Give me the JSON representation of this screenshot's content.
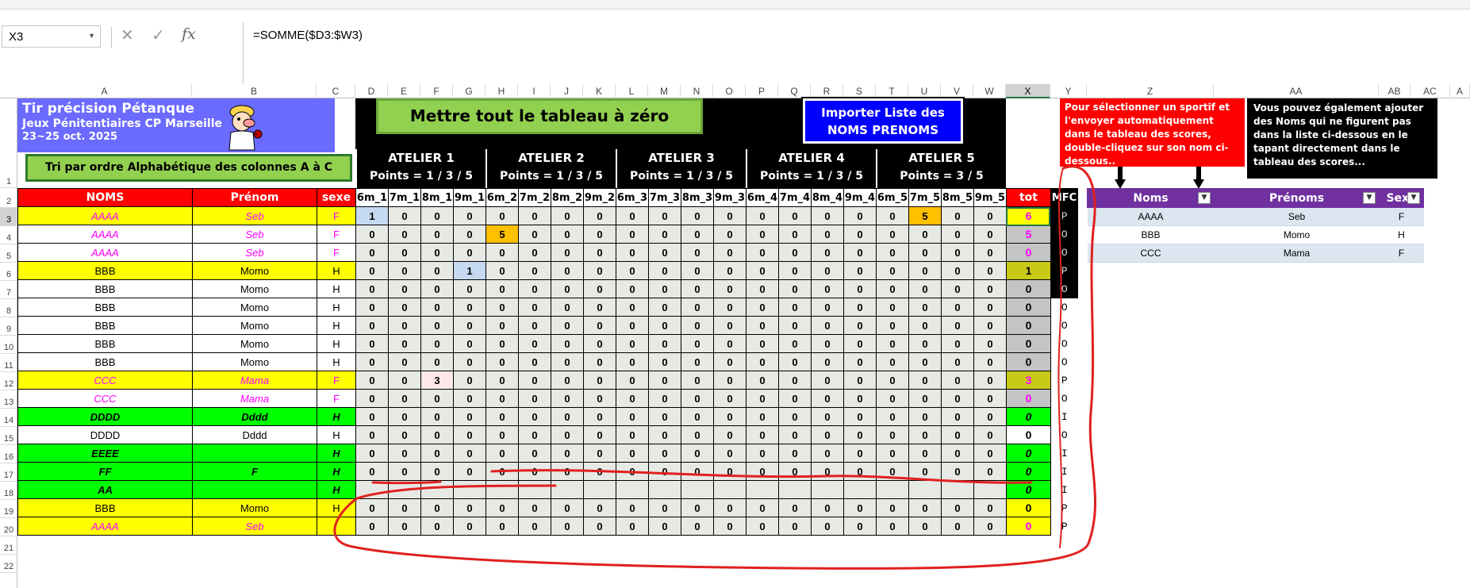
{
  "namebox": {
    "value": "X3"
  },
  "formula": {
    "value": "=SOMME($D3:$W3)"
  },
  "columns": [
    "A",
    "B",
    "C",
    "D",
    "E",
    "F",
    "G",
    "H",
    "I",
    "J",
    "K",
    "L",
    "M",
    "N",
    "O",
    "P",
    "Q",
    "R",
    "S",
    "T",
    "U",
    "V",
    "W",
    "X",
    "Y",
    "Z",
    "AA",
    "AB",
    "AC",
    "A"
  ],
  "row_numbers": [
    "1",
    "2",
    "3",
    "4",
    "5",
    "6",
    "7",
    "8",
    "9",
    "10",
    "11",
    "12",
    "13",
    "14",
    "15",
    "16",
    "17",
    "18",
    "19",
    "20",
    "21",
    "22"
  ],
  "title": {
    "main": "Tir précision Pétanque",
    "sub": "Jeux Pénitentiaires CP Marseille",
    "date": "23~25 oct. 2025"
  },
  "buttons": {
    "sort": "Tri par ordre Alphabétique des colonnes A à C",
    "reset": "Mettre tout le tableau à zéro",
    "import_line1": "Importer Liste des",
    "import_line2": "NOMS PRENOMS"
  },
  "ateliers": [
    {
      "name": "ATELIER 1",
      "points": "Points = 1 / 3 / 5"
    },
    {
      "name": "ATELIER 2",
      "points": "Points = 1 / 3 / 5"
    },
    {
      "name": "ATELIER 3",
      "points": "Points = 1 / 3 / 5"
    },
    {
      "name": "ATELIER 4",
      "points": "Points = 1 / 3 / 5"
    },
    {
      "name": "ATELIER 5",
      "points": "Points = 3 / 5"
    }
  ],
  "info_red": "Pour sélectionner un sportif et l'envoyer automatiquement dans le tableau des scores, double-cliquez sur son nom ci-dessous..",
  "info_black": "Vous pouvez également ajouter des Noms qui ne figurent pas dans la liste ci-dessous en le tapant directement dans le tableau des scores...",
  "headers": {
    "noms": "NOMS",
    "prenom": "Prénom",
    "sexe": "sexe",
    "tot": "tot",
    "mfc": "MFC",
    "scores": [
      "6m_1",
      "7m_1",
      "8m_1",
      "9m_1",
      "6m_2",
      "7m_2",
      "8m_2",
      "9m_2",
      "6m_3",
      "7m_3",
      "8m_3",
      "9m_3",
      "6m_4",
      "7m_4",
      "8m_4",
      "9m_4",
      "6m_5",
      "7m_5",
      "8m_5",
      "9m_5"
    ]
  },
  "rows": [
    {
      "nom": "AAAA",
      "prenom": "Seb",
      "sexe": "F",
      "style": "yellow-mag",
      "scores": [
        "1",
        "0",
        "0",
        "0",
        "0",
        "0",
        "0",
        "0",
        "0",
        "0",
        "0",
        "0",
        "0",
        "0",
        "0",
        "0",
        "0",
        "5",
        "0",
        "0"
      ],
      "tot": "6",
      "mfc": "P"
    },
    {
      "nom": "AAAA",
      "prenom": "Seb",
      "sexe": "F",
      "style": "white-mag",
      "scores": [
        "0",
        "0",
        "0",
        "0",
        "5",
        "0",
        "0",
        "0",
        "0",
        "0",
        "0",
        "0",
        "0",
        "0",
        "0",
        "0",
        "0",
        "0",
        "0",
        "0"
      ],
      "tot": "5",
      "mfc": "O"
    },
    {
      "nom": "AAAA",
      "prenom": "Seb",
      "sexe": "F",
      "style": "white-mag",
      "scores": [
        "0",
        "0",
        "0",
        "0",
        "0",
        "0",
        "0",
        "0",
        "0",
        "0",
        "0",
        "0",
        "0",
        "0",
        "0",
        "0",
        "0",
        "0",
        "0",
        "0"
      ],
      "tot": "0",
      "mfc": "O"
    },
    {
      "nom": "BBB",
      "prenom": "Momo",
      "sexe": "H",
      "style": "yellow",
      "scores": [
        "0",
        "0",
        "0",
        "1",
        "0",
        "0",
        "0",
        "0",
        "0",
        "0",
        "0",
        "0",
        "0",
        "0",
        "0",
        "0",
        "0",
        "0",
        "0",
        "0"
      ],
      "tot": "1",
      "mfc": "P"
    },
    {
      "nom": "BBB",
      "prenom": "Momo",
      "sexe": "H",
      "style": "white",
      "scores": [
        "0",
        "0",
        "0",
        "0",
        "0",
        "0",
        "0",
        "0",
        "0",
        "0",
        "0",
        "0",
        "0",
        "0",
        "0",
        "0",
        "0",
        "0",
        "0",
        "0"
      ],
      "tot": "0",
      "mfc": "O"
    },
    {
      "nom": "BBB",
      "prenom": "Momo",
      "sexe": "H",
      "style": "white",
      "scores": [
        "0",
        "0",
        "0",
        "0",
        "0",
        "0",
        "0",
        "0",
        "0",
        "0",
        "0",
        "0",
        "0",
        "0",
        "0",
        "0",
        "0",
        "0",
        "0",
        "0"
      ],
      "tot": "0",
      "mfc": "O"
    },
    {
      "nom": "BBB",
      "prenom": "Momo",
      "sexe": "H",
      "style": "white",
      "scores": [
        "0",
        "0",
        "0",
        "0",
        "0",
        "0",
        "0",
        "0",
        "0",
        "0",
        "0",
        "0",
        "0",
        "0",
        "0",
        "0",
        "0",
        "0",
        "0",
        "0"
      ],
      "tot": "0",
      "mfc": "O"
    },
    {
      "nom": "BBB",
      "prenom": "Momo",
      "sexe": "H",
      "style": "white",
      "scores": [
        "0",
        "0",
        "0",
        "0",
        "0",
        "0",
        "0",
        "0",
        "0",
        "0",
        "0",
        "0",
        "0",
        "0",
        "0",
        "0",
        "0",
        "0",
        "0",
        "0"
      ],
      "tot": "0",
      "mfc": "O"
    },
    {
      "nom": "BBB",
      "prenom": "Momo",
      "sexe": "H",
      "style": "white",
      "scores": [
        "0",
        "0",
        "0",
        "0",
        "0",
        "0",
        "0",
        "0",
        "0",
        "0",
        "0",
        "0",
        "0",
        "0",
        "0",
        "0",
        "0",
        "0",
        "0",
        "0"
      ],
      "tot": "0",
      "mfc": "O"
    },
    {
      "nom": "CCC",
      "prenom": "Mama",
      "sexe": "F",
      "style": "yellow-mag",
      "scores": [
        "0",
        "0",
        "3",
        "0",
        "0",
        "0",
        "0",
        "0",
        "0",
        "0",
        "0",
        "0",
        "0",
        "0",
        "0",
        "0",
        "0",
        "0",
        "0",
        "0"
      ],
      "tot": "3",
      "mfc": "P"
    },
    {
      "nom": "CCC",
      "prenom": "Mama",
      "sexe": "F",
      "style": "white-mag",
      "scores": [
        "0",
        "0",
        "0",
        "0",
        "0",
        "0",
        "0",
        "0",
        "0",
        "0",
        "0",
        "0",
        "0",
        "0",
        "0",
        "0",
        "0",
        "0",
        "0",
        "0"
      ],
      "tot": "0",
      "mfc": "O"
    },
    {
      "nom": "DDDD",
      "prenom": "Dddd",
      "sexe": "H",
      "style": "green",
      "scores": [
        "0",
        "0",
        "0",
        "0",
        "0",
        "0",
        "0",
        "0",
        "0",
        "0",
        "0",
        "0",
        "0",
        "0",
        "0",
        "0",
        "0",
        "0",
        "0",
        "0"
      ],
      "tot": "0",
      "mfc": "I"
    },
    {
      "nom": "DDDD",
      "prenom": "Dddd",
      "sexe": "H",
      "style": "white",
      "scores": [
        "0",
        "0",
        "0",
        "0",
        "0",
        "0",
        "0",
        "0",
        "0",
        "0",
        "0",
        "0",
        "0",
        "0",
        "0",
        "0",
        "0",
        "0",
        "0",
        "0"
      ],
      "tot": "0",
      "mfc": "O"
    },
    {
      "nom": "EEEE",
      "prenom": "",
      "sexe": "H",
      "style": "green",
      "scores": [
        "0",
        "0",
        "0",
        "0",
        "0",
        "0",
        "0",
        "0",
        "0",
        "0",
        "0",
        "0",
        "0",
        "0",
        "0",
        "0",
        "0",
        "0",
        "0",
        "0"
      ],
      "tot": "0",
      "mfc": "I"
    },
    {
      "nom": "FF",
      "prenom": "F",
      "sexe": "H",
      "style": "green",
      "scores": [
        "0",
        "0",
        "0",
        "0",
        "0",
        "0",
        "0",
        "0",
        "0",
        "0",
        "0",
        "0",
        "0",
        "0",
        "0",
        "0",
        "0",
        "0",
        "0",
        "0"
      ],
      "tot": "0",
      "mfc": "I"
    },
    {
      "nom": "AA",
      "prenom": "",
      "sexe": "H",
      "style": "green",
      "scores": [
        "",
        "",
        "",
        "",
        "",
        "",
        "",
        "",
        "",
        "",
        "",
        "",
        "",
        "",
        "",
        "",
        "",
        "",
        "",
        ""
      ],
      "tot": "0",
      "mfc": "I"
    },
    {
      "nom": "BBB",
      "prenom": "Momo",
      "sexe": "H",
      "style": "yellow",
      "scores": [
        "0",
        "0",
        "0",
        "0",
        "0",
        "0",
        "0",
        "0",
        "0",
        "0",
        "0",
        "0",
        "0",
        "0",
        "0",
        "0",
        "0",
        "0",
        "0",
        "0"
      ],
      "tot": "0",
      "mfc": "P"
    },
    {
      "nom": "AAAA",
      "prenom": "Seb",
      "sexe": "",
      "style": "yellow-mag",
      "scores": [
        "0",
        "0",
        "0",
        "0",
        "0",
        "0",
        "0",
        "0",
        "0",
        "0",
        "0",
        "0",
        "0",
        "0",
        "0",
        "0",
        "0",
        "0",
        "0",
        "0"
      ],
      "tot": "0",
      "mfc": "P"
    }
  ],
  "lookup": {
    "headers": [
      "Noms",
      "Prénoms",
      "Sexe"
    ],
    "rows": [
      [
        "AAAA",
        "Seb",
        "F"
      ],
      [
        "BBB",
        "Momo",
        "H"
      ],
      [
        "CCC",
        "Mama",
        "F"
      ]
    ]
  },
  "colors": {
    "accent_green": "#217346",
    "annotation_red": "#e02020"
  }
}
